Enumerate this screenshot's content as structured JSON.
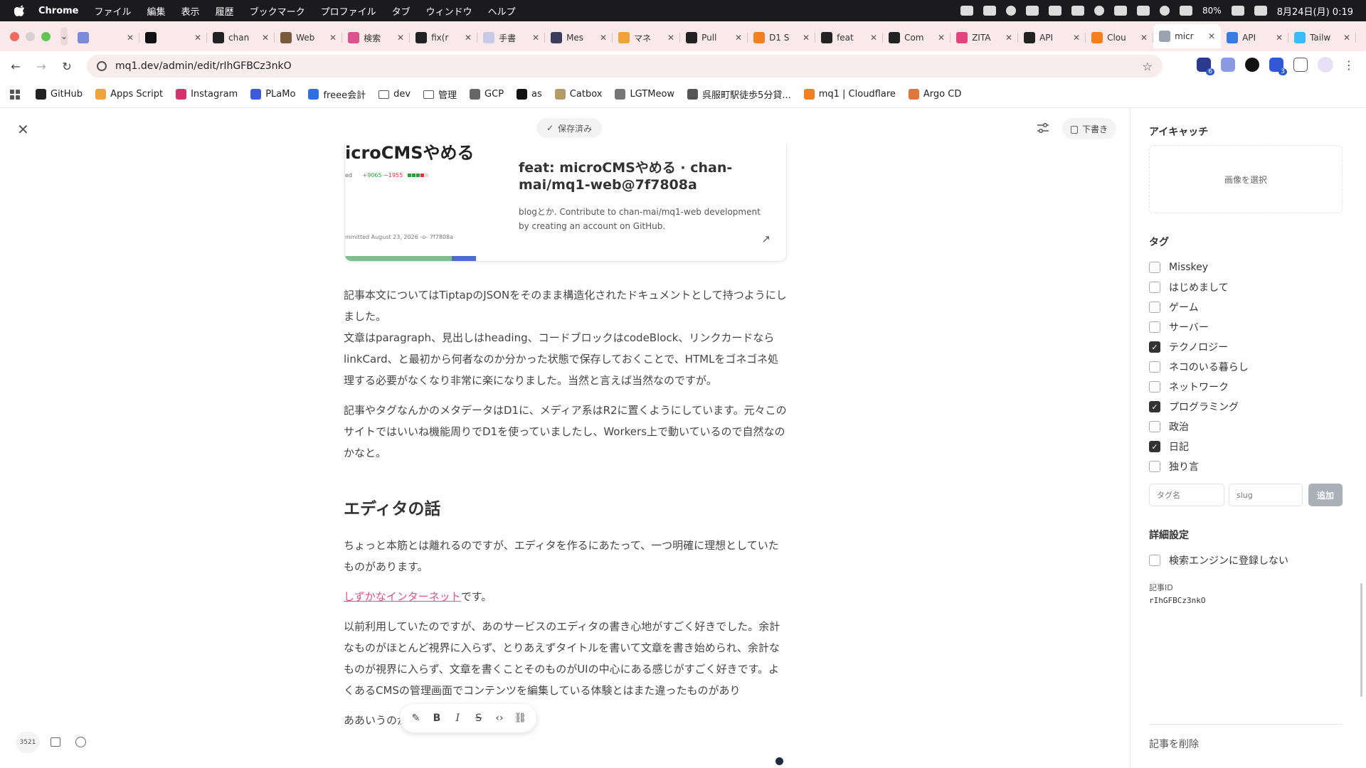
{
  "menubar": {
    "app": "Chrome",
    "items": [
      "ファイル",
      "編集",
      "表示",
      "履歴",
      "ブックマーク",
      "プロファイル",
      "タブ",
      "ウィンドウ",
      "ヘルプ"
    ],
    "battery": "80%",
    "clock": "8月24日(月) 0:19"
  },
  "tabs": [
    {
      "title": "",
      "color": "#7b8bd8"
    },
    {
      "title": "",
      "color": "#111111"
    },
    {
      "title": "chan",
      "color": "#222222"
    },
    {
      "title": "Web",
      "color": "#7a5a3c"
    },
    {
      "title": "検索",
      "color": "#d9548a"
    },
    {
      "title": "fix(r",
      "color": "#222222"
    },
    {
      "title": "手書",
      "color": "#c9c9e8"
    },
    {
      "title": "Mes",
      "color": "#3b3b5c"
    },
    {
      "title": "マネ",
      "color": "#f0a33a"
    },
    {
      "title": "Pull",
      "color": "#222222"
    },
    {
      "title": "D1 S",
      "color": "#f38020"
    },
    {
      "title": "feat",
      "color": "#222222"
    },
    {
      "title": "Com",
      "color": "#222222"
    },
    {
      "title": "ZITA",
      "color": "#e0457b"
    },
    {
      "title": "API",
      "color": "#222222"
    },
    {
      "title": "Clou",
      "color": "#f38020"
    },
    {
      "title": "micr",
      "color": "#9aa4ae",
      "active": true
    },
    {
      "title": "API",
      "color": "#3b7be0"
    },
    {
      "title": "Tailw",
      "color": "#38bdf8"
    }
  ],
  "url": "mq1.dev/admin/edit/rIhGFBCz3nkO",
  "bookmarks": [
    {
      "label": "GitHub",
      "color": "#222222"
    },
    {
      "label": "Apps Script",
      "color": "#f0a33a"
    },
    {
      "label": "Instagram",
      "color": "#d6336c"
    },
    {
      "label": "PLaMo",
      "color": "#3b5bdb"
    },
    {
      "label": "freee会計",
      "color": "#2f6fe0"
    },
    {
      "label": "dev",
      "folder": true
    },
    {
      "label": "管理",
      "folder": true
    },
    {
      "label": "GCP",
      "color": "#666666"
    },
    {
      "label": "as",
      "color": "#111111"
    },
    {
      "label": "Catbox",
      "color": "#b59a6a"
    },
    {
      "label": "LGTMeow",
      "color": "#777777"
    },
    {
      "label": "呉服町駅徒歩5分貸...",
      "color": "#555555"
    },
    {
      "label": "mq1 | Cloudflare",
      "color": "#f38020"
    },
    {
      "label": "Argo CD",
      "color": "#e0763a"
    }
  ],
  "editor": {
    "save_status": "保存済み",
    "draft_button": "下書き",
    "word_count": "3521"
  },
  "link_card": {
    "thumb_title": "icroCMSやめる",
    "thumb_stat_prefix": "ed",
    "thumb_add": "+9065",
    "thumb_del": "−1955",
    "thumb_commit": "mmitted August 23, 2026  -o-  7f7808a",
    "title": "feat: microCMSやめる · chan-mai/mq1-web@7f7808a",
    "description": "blogとか. Contribute to chan-mai/mq1-web development by creating an account on GitHub."
  },
  "article": {
    "p1_line1": "記事本文についてはTiptapのJSONをそのまま構造化されたドキュメントとして持つようにしました。",
    "p1_line2": "文章はparagraph、見出しはheading、コードブロックはcodeBlock、リンクカードならlinkCard、と最初から何者なのか分かった状態で保存しておくことで、HTMLをゴネゴネ処理する必要がなくなり非常に楽になりました。当然と言えば当然なのですが。",
    "p2": "記事やタグなんかのメタデータはD1に、メディア系はR2に置くようにしています。元々このサイトではいいね機能周りでD1を使っていましたし、Workers上で動いているので自然なのかなと。",
    "h2": "エディタの話",
    "p3": "ちょっと本筋とは離れるのですが、エディタを作るにあたって、一つ明確に理想としていたものがあります。",
    "link_text": "しずかなインターネット",
    "link_suffix": "です。",
    "p5": "以前利用していたのですが、あのサービスのエディタの書き心地がすごく好きでした。余計なものがほとんど視界に入らず、とりあえずタイトルを書いて文章を書き始められ、余計なものが視界に入らず、文章を書くことそのものがUIの中心にある感じがすごく好きです。よくあるCMSの管理画面でコンテンツを編集している体験とはまた違ったものがあり",
    "p6": "ああいうのがいいなと。"
  },
  "sidebar": {
    "eyecatch_heading": "アイキャッチ",
    "select_image": "画像を選択",
    "tags_heading": "タグ",
    "tags": [
      {
        "label": "Misskey",
        "checked": false
      },
      {
        "label": "はじめまして",
        "checked": false
      },
      {
        "label": "ゲーム",
        "checked": false
      },
      {
        "label": "サーバー",
        "checked": false
      },
      {
        "label": "テクノロジー",
        "checked": true
      },
      {
        "label": "ネコのいる暮らし",
        "checked": false
      },
      {
        "label": "ネットワーク",
        "checked": false
      },
      {
        "label": "プログラミング",
        "checked": true
      },
      {
        "label": "政治",
        "checked": false
      },
      {
        "label": "日記",
        "checked": true
      },
      {
        "label": "独り言",
        "checked": false
      }
    ],
    "tag_name_placeholder": "タグ名",
    "slug_placeholder": "slug",
    "add_button": "追加",
    "details_heading": "詳細設定",
    "seo_noindex": "検索エンジンに登録しない",
    "article_id_label": "記事ID",
    "article_id": "rIhGFBCz3nkO",
    "delete": "記事を削除"
  }
}
